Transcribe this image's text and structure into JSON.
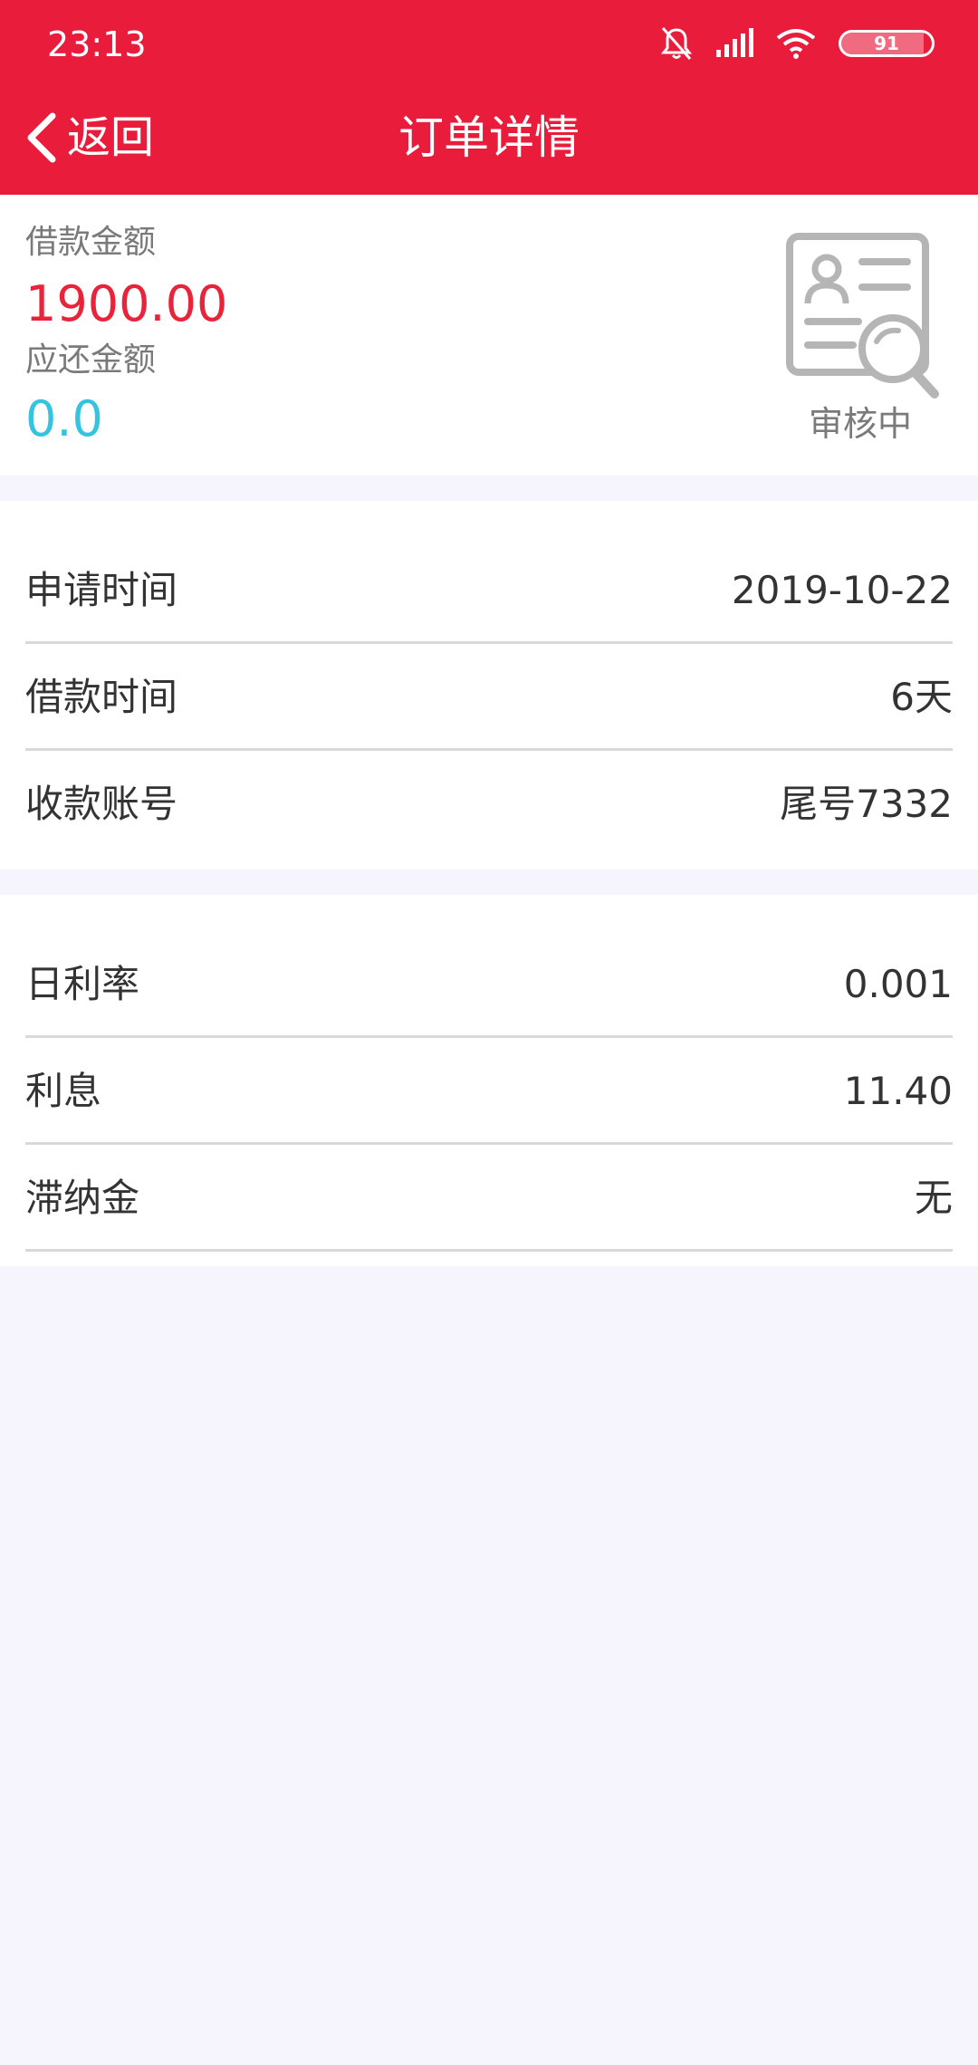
{
  "status_bar": {
    "time": "23:13",
    "battery": "91",
    "battery_level": 0.91,
    "icons": [
      "bell-off-icon",
      "signal-icon",
      "wifi-icon",
      "battery-icon"
    ]
  },
  "header": {
    "back_label": "返回",
    "title": "订单详情"
  },
  "summary": {
    "loan_amount_label": "借款金额",
    "loan_amount": "1900.00",
    "repay_amount_label": "应还金额",
    "repay_amount": "0.0",
    "review_status": "审核中",
    "review_icon": "document-search-icon"
  },
  "details_1": [
    {
      "label": "申请时间",
      "value": "2019-10-22"
    },
    {
      "label": "借款时间",
      "value": "6天"
    },
    {
      "label": "收款账号",
      "value": "尾号7332"
    }
  ],
  "details_2": [
    {
      "label": "日利率",
      "value": "0.001"
    },
    {
      "label": "利息",
      "value": "11.40"
    },
    {
      "label": "滞纳金",
      "value": "无"
    }
  ],
  "colors": {
    "brand": "#e91c3b",
    "loan_amount": "#e9243a",
    "repay_amount": "#35c4df",
    "background": "#f6f5fd"
  }
}
